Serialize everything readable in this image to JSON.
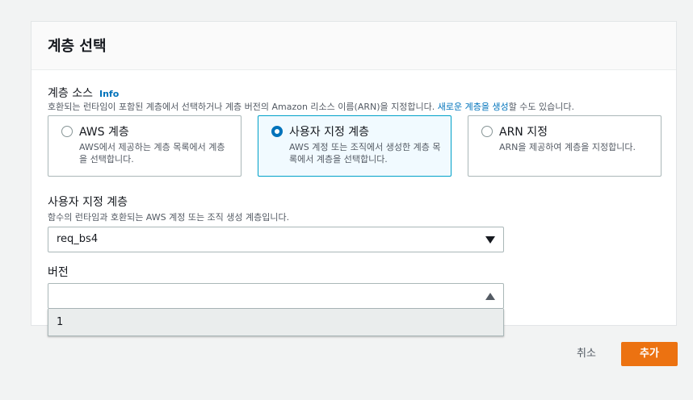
{
  "panel": {
    "title": "계층 선택"
  },
  "layer_source": {
    "label": "계층 소스",
    "info": "Info",
    "description_prefix": "호환되는 런타임이 포함된 계층에서 선택하거나 계층 버전의 Amazon 리소스 이름(ARN)을 지정합니다. ",
    "description_link": "새로운 계층을 생성",
    "description_suffix": "할 수도 있습니다.",
    "options": [
      {
        "title": "AWS 계층",
        "description": "AWS에서 제공하는 계층 목록에서 계층을 선택합니다.",
        "selected": false
      },
      {
        "title": "사용자 지정 계층",
        "description": "AWS 계정 또는 조직에서 생성한 계층 목록에서 계층을 선택합니다.",
        "selected": true
      },
      {
        "title": "ARN 지정",
        "description": "ARN을 제공하여 계층을 지정합니다.",
        "selected": false
      }
    ]
  },
  "custom_layer": {
    "label": "사용자 지정 계층",
    "description": "함수의 런타임과 호환되는 AWS 계정 또는 조직 생성 계층입니다.",
    "value": "req_bs4"
  },
  "version": {
    "label": "버전",
    "value": "",
    "options": [
      "1"
    ]
  },
  "footer": {
    "cancel": "취소",
    "add": "추가"
  },
  "colors": {
    "accent": "#ec7211",
    "link": "#0073bb",
    "selected_border": "#00a1c9"
  }
}
